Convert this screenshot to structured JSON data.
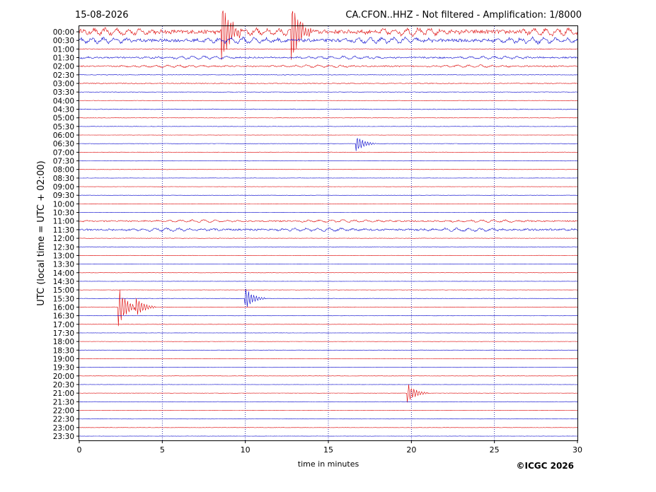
{
  "header": {
    "date": "15-08-2026",
    "station_title": "CA.CFON..HHZ - Not filtered - Amplification: 1/8000"
  },
  "credit": "©ICGC 2026",
  "colors": {
    "trace_a": "#dd0000",
    "trace_b": "#0000cc",
    "grid": "#000099",
    "frame": "#000000"
  },
  "chart_data": {
    "type": "line",
    "title": "CA.CFON..HHZ - Not filtered - Amplification: 1/8000",
    "xlabel": "time in minutes",
    "ylabel": "UTC (local time = UTC + 02:00)",
    "xlim": [
      0,
      30
    ],
    "x_ticks": [
      "0",
      "5",
      "10",
      "15",
      "20",
      "25",
      "30"
    ],
    "x_tick_values": [
      0,
      5,
      10,
      15,
      20,
      25,
      30
    ],
    "grid": "vertical dotted at 5, 10, 15, 20, 25",
    "row_labels": [
      "00:00",
      "00:30",
      "01:00",
      "01:30",
      "02:00",
      "02:30",
      "03:00",
      "03:30",
      "04:00",
      "04:30",
      "05:00",
      "05:30",
      "06:00",
      "06:30",
      "07:00",
      "07:30",
      "08:00",
      "08:30",
      "09:00",
      "09:30",
      "10:00",
      "10:30",
      "11:00",
      "11:30",
      "12:00",
      "12:30",
      "13:00",
      "13:30",
      "14:00",
      "14:30",
      "15:00",
      "15:30",
      "16:00",
      "16:30",
      "17:00",
      "17:30",
      "18:00",
      "18:30",
      "19:00",
      "19:30",
      "20:00",
      "20:30",
      "21:00",
      "21:30",
      "22:00",
      "22:30",
      "23:00",
      "23:30"
    ],
    "row_noise": [
      0.9,
      0.7,
      0.15,
      0.35,
      0.3,
      0.12,
      0.18,
      0.1,
      0.12,
      0.15,
      0.12,
      0.08,
      0.06,
      0.08,
      0.1,
      0.08,
      0.06,
      0.06,
      0.06,
      0.06,
      0.06,
      0.06,
      0.3,
      0.4,
      0.1,
      0.08,
      0.08,
      0.06,
      0.06,
      0.06,
      0.06,
      0.08,
      0.1,
      0.08,
      0.06,
      0.06,
      0.06,
      0.06,
      0.06,
      0.06,
      0.06,
      0.06,
      0.06,
      0.06,
      0.06,
      0.06,
      0.06,
      0.06
    ],
    "spikes": [
      {
        "row": "00:00",
        "minute": 8.6,
        "amp": 1.0
      },
      {
        "row": "00:00",
        "minute": 12.8,
        "amp": 1.0
      },
      {
        "row": "06:30",
        "minute": 16.7,
        "amp": 0.25
      },
      {
        "row": "15:30",
        "minute": 10.0,
        "amp": 0.35
      },
      {
        "row": "16:00",
        "minute": 2.4,
        "amp": 0.6
      },
      {
        "row": "16:00",
        "minute": 3.4,
        "amp": 0.35
      },
      {
        "row": "21:00",
        "minute": 19.8,
        "amp": 0.3
      }
    ]
  }
}
